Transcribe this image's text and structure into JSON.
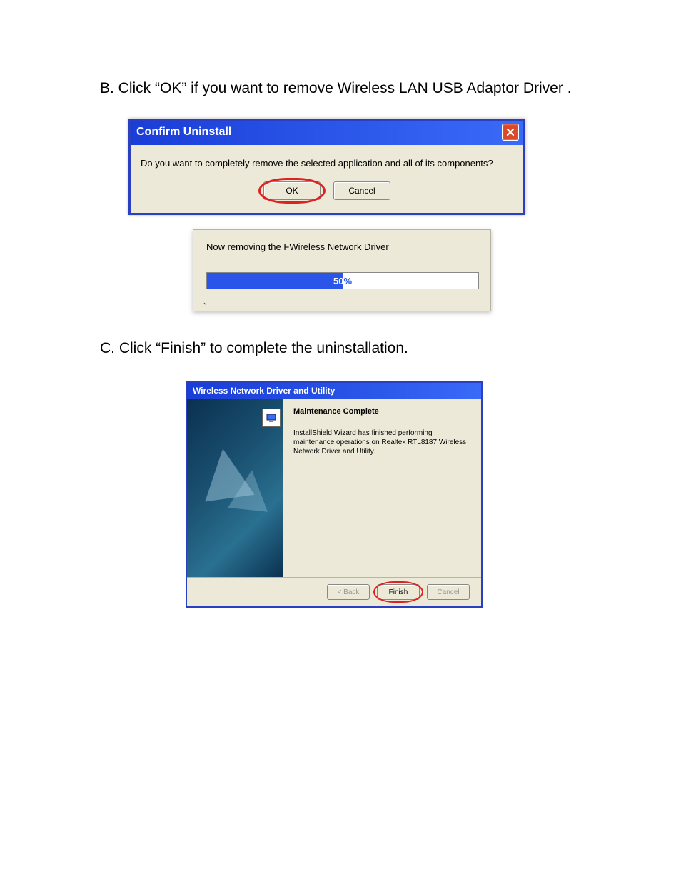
{
  "step_b": {
    "text": "B. Click “OK” if you want to remove Wireless LAN USB Adaptor Driver ."
  },
  "dialog1": {
    "title": "Confirm Uninstall",
    "message": "Do you want to completely remove the selected application and all of its components?",
    "ok_label": "OK",
    "cancel_label": "Cancel"
  },
  "progress": {
    "message": "Now removing the FWireless Network Driver",
    "percent_white": "50",
    "percent_black": "%",
    "value": 50
  },
  "step_c": {
    "text": "C. Click “Finish” to complete the uninstallation."
  },
  "dialog3": {
    "title": "Wireless Network Driver and Utility",
    "heading": "Maintenance Complete",
    "body": "InstallShield Wizard has finished performing maintenance operations on Realtek RTL8187 Wireless Network Driver and Utility.",
    "back_label": "< Back",
    "finish_label": "Finish",
    "cancel_label": "Cancel"
  }
}
